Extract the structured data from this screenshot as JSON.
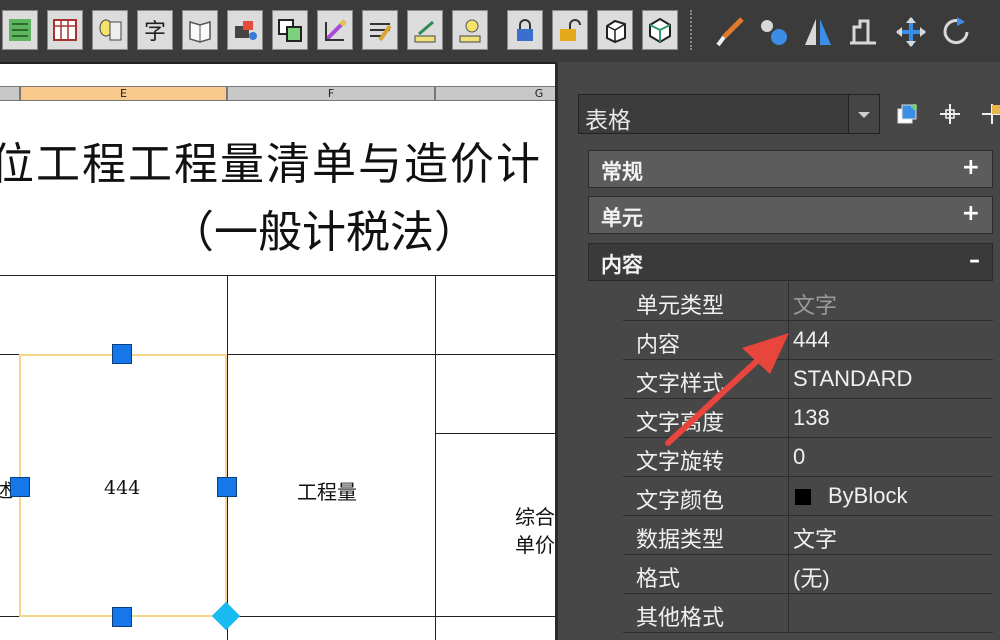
{
  "toolbar": {
    "buttons": [
      "layer-icon",
      "table-icon",
      "calculator-icon",
      "text-style-icon",
      "book-icon",
      "block-icon",
      "copy-icon",
      "match-icon",
      "edit-icon",
      "dimension-icon",
      "attribute-icon",
      "lock-icon",
      "unlock-icon",
      "box-icon",
      "solid-icon"
    ],
    "text_style_glyph": "字",
    "tools_right": [
      "brush-icon",
      "circles-icon",
      "mirror-icon",
      "stretch-icon",
      "move-icon",
      "rotate-icon"
    ]
  },
  "sheet": {
    "columns": [
      "E",
      "F",
      "G"
    ],
    "title_line1": "位工程工程量清单与造价计",
    "title_line2": "（一般计税法）",
    "cell_selected_value": "444",
    "cell_quantity_label": "工程量",
    "cell_unit_price_line1": "综合",
    "cell_unit_price_line2": "单价",
    "left_clip_char": "述"
  },
  "palette": {
    "object_type": "表格",
    "sections": [
      {
        "label": "常规",
        "toggle": "+"
      },
      {
        "label": "单元",
        "toggle": "+"
      },
      {
        "label": "内容",
        "toggle": "–"
      }
    ],
    "properties": [
      {
        "name": "单元类型",
        "value": "文字"
      },
      {
        "name": "内容",
        "value": "444"
      },
      {
        "name": "文字样式",
        "value": "STANDARD"
      },
      {
        "name": "文字高度",
        "value": "138"
      },
      {
        "name": "文字旋转",
        "value": "0"
      },
      {
        "name": "文字颜色",
        "value": "ByBlock"
      },
      {
        "name": "数据类型",
        "value": "文字"
      },
      {
        "name": "格式",
        "value": "(无)"
      },
      {
        "name": "其他格式",
        "value": ""
      }
    ]
  },
  "colors": {
    "grip": "#1577e8",
    "grip_corner": "#19b9f2",
    "selection_border": "#f6d58a",
    "annotation_arrow": "#e8453c",
    "palette_bg": "#474747"
  }
}
